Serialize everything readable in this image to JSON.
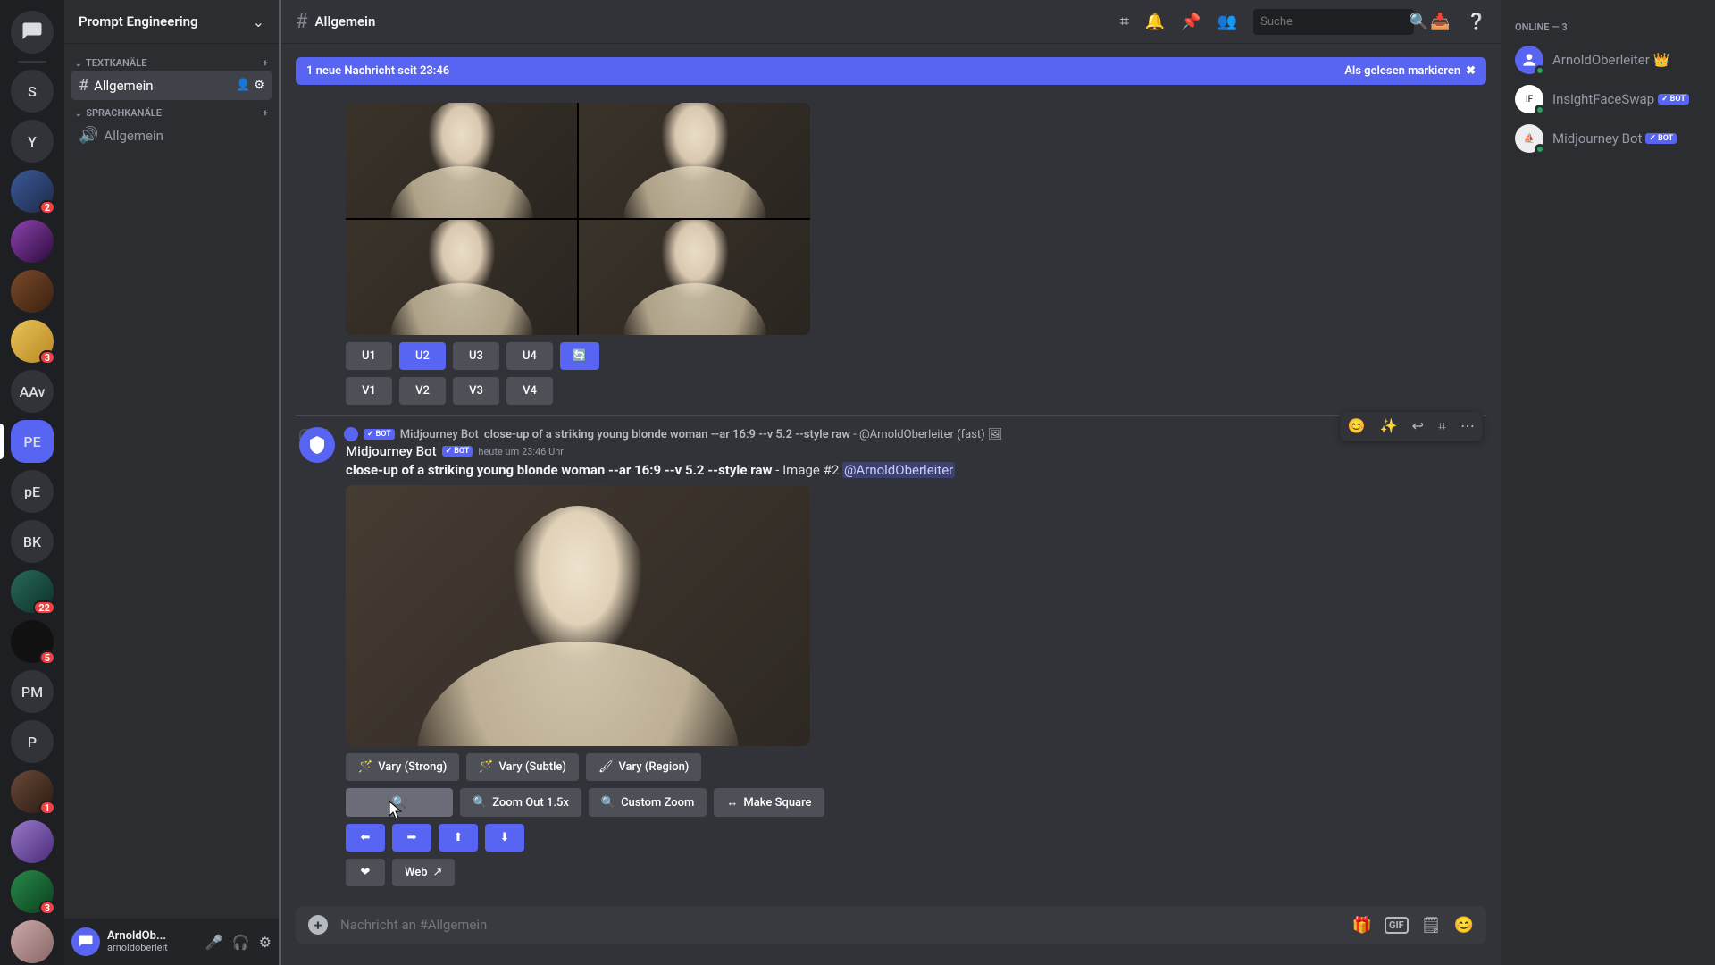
{
  "server_rail": {
    "items": [
      {
        "kind": "home",
        "label": "S"
      },
      {
        "kind": "text",
        "label": "Y"
      },
      {
        "kind": "img",
        "label": "",
        "badge": "2"
      },
      {
        "kind": "img",
        "label": ""
      },
      {
        "kind": "img",
        "label": ""
      },
      {
        "kind": "img",
        "label": "",
        "badge": "3"
      },
      {
        "kind": "text",
        "label": "AAv"
      },
      {
        "kind": "text",
        "label": "PE",
        "active": true
      },
      {
        "kind": "text",
        "label": "pE"
      },
      {
        "kind": "text",
        "label": "BK"
      },
      {
        "kind": "img",
        "label": "",
        "badge": "22"
      },
      {
        "kind": "img",
        "label": "",
        "badge": "5"
      },
      {
        "kind": "text",
        "label": "PM"
      },
      {
        "kind": "text",
        "label": "P"
      },
      {
        "kind": "img",
        "label": "",
        "badge": "1"
      },
      {
        "kind": "img",
        "label": ""
      },
      {
        "kind": "img",
        "label": "",
        "badge": "3"
      },
      {
        "kind": "img",
        "label": ""
      }
    ]
  },
  "server_header": {
    "name": "Prompt Engineering"
  },
  "categories": [
    {
      "name": "TEXTKANÄLE",
      "items": [
        {
          "name": "Allgemein",
          "active": true,
          "trail": true
        }
      ]
    },
    {
      "name": "SPRACHKANÄLE",
      "items": [
        {
          "name": "Allgemein"
        }
      ]
    }
  ],
  "user_panel": {
    "name": "ArnoldOb...",
    "sub": "arnoldoberleit"
  },
  "chat_header": {
    "channel": "Allgemein",
    "search_placeholder": "Suche"
  },
  "unread_bar": {
    "text": "1 neue Nachricht seit 23:46",
    "mark": "Als gelesen markieren"
  },
  "msg1": {
    "buttons_u": [
      "U1",
      "U2",
      "U3",
      "U4"
    ],
    "buttons_v": [
      "V1",
      "V2",
      "V3",
      "V4"
    ]
  },
  "msg2": {
    "reply_author": "Midjourney Bot",
    "reply_text": "close-up of a striking young blonde woman --ar 16:9 --v 5.2 --style raw - @ArnoldOberleiter (fast)",
    "author": "Midjourney Bot",
    "time": "heute um 23:46 Uhr",
    "prompt": "close-up of a striking young blonde woman --ar 16:9 --v 5.2 --style raw",
    "suffix": " - Image #2 ",
    "mention": "@ArnoldOberleiter",
    "row1": [
      "Vary (Strong)",
      "Vary (Subtle)",
      "Vary (Region)"
    ],
    "row2": [
      "",
      "Zoom Out 1.5x",
      "Custom Zoom",
      "Make Square"
    ],
    "web": "Web"
  },
  "input": {
    "placeholder": "Nachricht an #Allgemein"
  },
  "members": {
    "heading": "ONLINE — 3",
    "list": [
      {
        "name": "ArnoldOberleiter",
        "crown": true
      },
      {
        "name": "InsightFaceSwap",
        "bot": true
      },
      {
        "name": "Midjourney Bot",
        "bot": true
      }
    ]
  },
  "bot_tag": "BOT"
}
